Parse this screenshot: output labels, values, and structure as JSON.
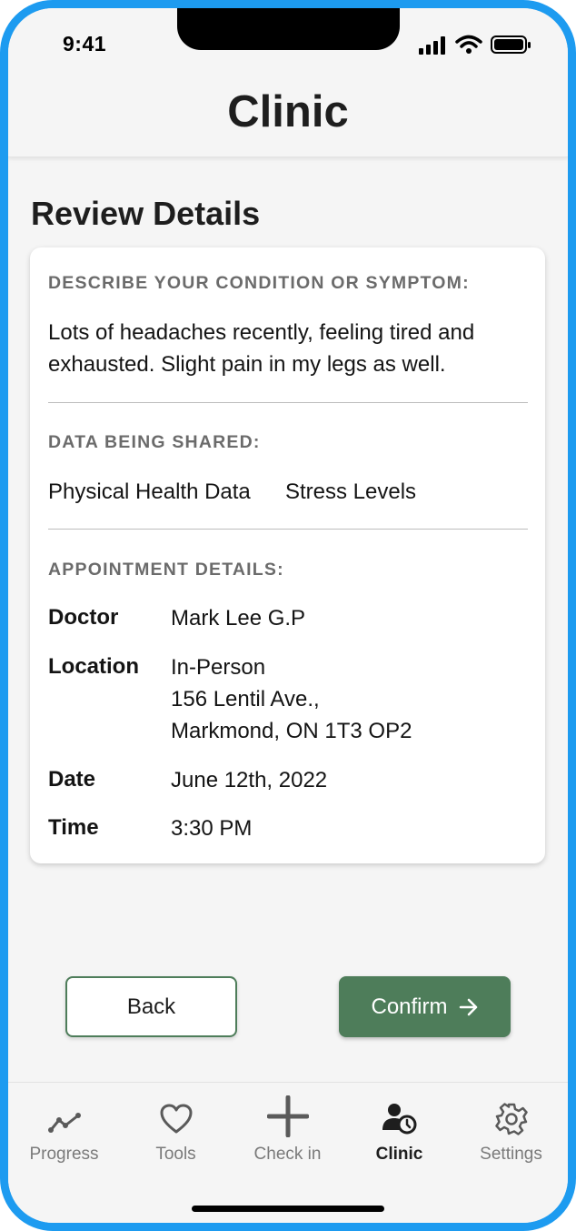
{
  "status_bar": {
    "time": "9:41"
  },
  "header": {
    "title": "Clinic"
  },
  "review": {
    "title": "Review Details",
    "condition": {
      "label": "DESCRIBE YOUR CONDITION OR SYMPTOM:",
      "text": "Lots of headaches recently, feeling tired and exhausted. Slight pain in my legs as well."
    },
    "data_shared": {
      "label": "DATA BEING SHARED:",
      "items": [
        "Physical Health Data",
        "Stress Levels"
      ]
    },
    "appointment": {
      "label": "APPOINTMENT DETAILS:",
      "doctor_key": "Doctor",
      "doctor": "Mark Lee G.P",
      "location_key": "Location",
      "location_lines": [
        "In-Person",
        "156 Lentil Ave.,",
        "Markmond, ON 1T3 OP2"
      ],
      "date_key": "Date",
      "date": "June 12th, 2022",
      "time_key": "Time",
      "time": "3:30 PM"
    }
  },
  "actions": {
    "back_label": "Back",
    "confirm_label": "Confirm"
  },
  "tabs": [
    {
      "label": "Progress",
      "icon": "progress-icon"
    },
    {
      "label": "Tools",
      "icon": "heart-icon"
    },
    {
      "label": "Check in",
      "icon": "plus-icon"
    },
    {
      "label": "Clinic",
      "icon": "clinic-icon",
      "active": true
    },
    {
      "label": "Settings",
      "icon": "gear-icon"
    }
  ],
  "colors": {
    "accent": "#4e7d5a",
    "frame": "#1d9bf0"
  }
}
